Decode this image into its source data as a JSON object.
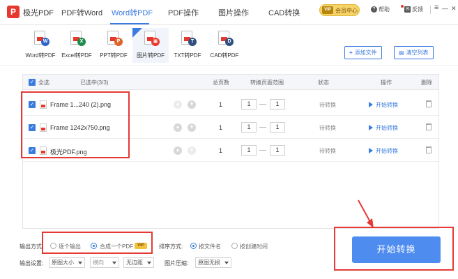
{
  "app": {
    "logo_glyph": "P",
    "title": "极光PDF"
  },
  "nav": {
    "tabs": [
      "PDF转Word",
      "Word转PDF",
      "PDF操作",
      "图片操作",
      "CAD转换"
    ],
    "active_index": 1
  },
  "topbar": {
    "vip_badge": "VIP",
    "vip_label": "会员中心",
    "help_label": "帮助",
    "feedback_label": "反馈",
    "menu_glyph": "≡",
    "minimize_glyph": "—",
    "close_glyph": "✕"
  },
  "tools": {
    "active_index": 3,
    "items": [
      {
        "label": "Word转PDF",
        "badge": "W",
        "color": "#2b63c7"
      },
      {
        "label": "Excel转PDF",
        "badge": "X",
        "color": "#1f8a4c"
      },
      {
        "label": "PPT转PDF",
        "badge": "P",
        "color": "#e0632a"
      },
      {
        "label": "图片转PDF",
        "badge": "▣",
        "color": "#e8372c"
      },
      {
        "label": "TXT转PDF",
        "badge": "T",
        "color": "#2f4f7f"
      },
      {
        "label": "CAD转PDF",
        "badge": "D",
        "color": "#2f4f7f"
      }
    ],
    "add_file_label": "添加文件",
    "add_file_icon": "+",
    "clear_list_label": "清空列表",
    "clear_list_icon": "▤"
  },
  "list": {
    "header": {
      "select_all": "全选",
      "selected_count": "已选中(3/3)",
      "total_pages": "总页数",
      "page_range": "转换页面范围",
      "status": "状态",
      "actions": "操作",
      "delete": "删除"
    },
    "rows": [
      {
        "name": "Frame 1...240 (2).png",
        "pages": "1",
        "from": "1",
        "to": "1",
        "status": "待转换",
        "action": "开始转换"
      },
      {
        "name": "Frame 1242x750.png",
        "pages": "1",
        "from": "1",
        "to": "1",
        "status": "待转换",
        "action": "开始转换"
      },
      {
        "name": "极光PDF.png",
        "pages": "1",
        "from": "1",
        "to": "1",
        "status": "待转换",
        "action": "开始转换"
      }
    ]
  },
  "options": {
    "output_mode_label": "输出方式:",
    "output_each": "逐个输出",
    "output_merge": "合成一个PDF",
    "vip_tag": "VIP",
    "sort_label": "排序方式:",
    "sort_by_name": "按文件名",
    "sort_by_time": "按创建时间",
    "settings_label": "输出设置:",
    "page_size": "原图大小",
    "orientation": "横向",
    "margin": "无边距",
    "compress_label": "图片压缩:",
    "compress_value": "原图无损"
  },
  "convert_button": "开始转换",
  "colors": {
    "accent": "#3a7be0",
    "annotation": "#e53935",
    "primary_button": "#4f8cf0"
  }
}
